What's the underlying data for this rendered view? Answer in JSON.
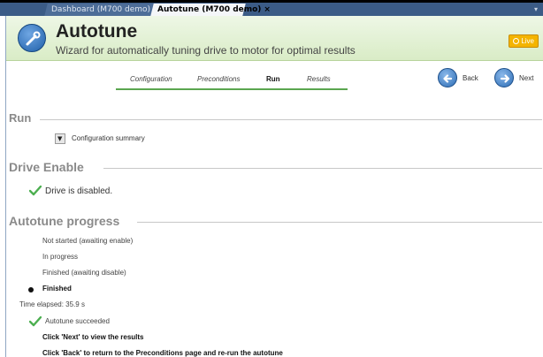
{
  "tabs": [
    {
      "label": "Dashboard (M700 demo)",
      "close": "x",
      "active": false
    },
    {
      "label": "Autotune (M700 demo)",
      "close": "×",
      "active": true
    }
  ],
  "header": {
    "title": "Autotune",
    "subtitle": "Wizard for automatically tuning drive to motor for optimal results",
    "badge": "Live",
    "icon": "wrench-icon"
  },
  "steps": {
    "items": [
      "Configuration",
      "Preconditions",
      "Run",
      "Results"
    ],
    "active": "Run",
    "back_label": "Back",
    "next_label": "Next"
  },
  "run": {
    "heading": "Run",
    "summary_label": "Configuration summary"
  },
  "drive_enable": {
    "heading": "Drive Enable",
    "status": "Drive is disabled."
  },
  "progress": {
    "heading": "Autotune progress",
    "states": [
      "Not started (awaiting enable)",
      "In progress",
      "Finished (awaiting disable)",
      "Finished"
    ],
    "current_state": "Finished",
    "elapsed": "Time elapsed: 35.9 s",
    "result": "Autotune succeeded",
    "hint_next": "Click 'Next' to view the results",
    "hint_back": "Click 'Back' to return to the Preconditions page and re-run the autotune"
  },
  "colors": {
    "tabbar": "#3b5b86",
    "header_bg": "#d9ecc6",
    "accent_green": "#5aa64f",
    "badge": "#f4b400",
    "nav_button": "#2d6db5"
  }
}
